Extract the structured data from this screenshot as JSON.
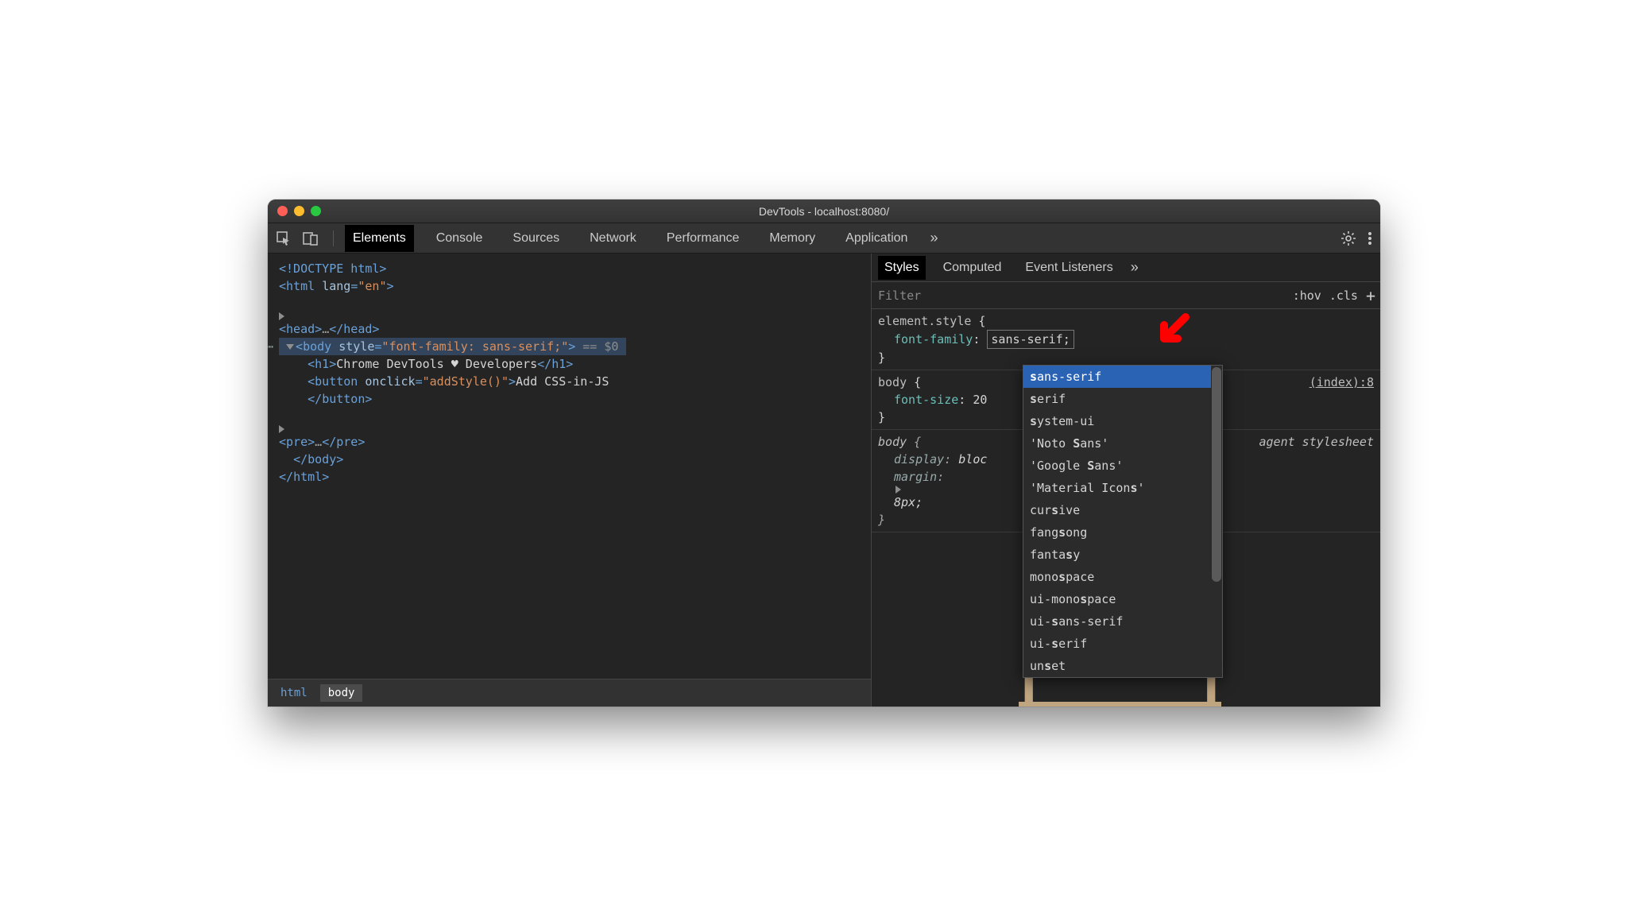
{
  "window": {
    "title": "DevTools - localhost:8080/"
  },
  "toolbar": {
    "tabs": [
      "Elements",
      "Console",
      "Sources",
      "Network",
      "Performance",
      "Memory",
      "Application"
    ],
    "active": 0
  },
  "dom": {
    "doctype": "<!DOCTYPE html>",
    "html_open": {
      "tag": "html",
      "attr": "lang",
      "val": "en"
    },
    "head_open": "head",
    "head_ell": "…",
    "body": {
      "tag": "body",
      "attr": "style",
      "val": "font-family: sans-serif;",
      "eq": "== $0"
    },
    "h1": {
      "tag": "h1",
      "text": "Chrome DevTools ♥ Developers"
    },
    "button": {
      "tag": "button",
      "attr": "onclick",
      "val": "addStyle()",
      "text": "Add CSS-in-JS"
    },
    "pre": {
      "tag": "pre",
      "ell": "…"
    },
    "body_close": "body",
    "html_close": "html"
  },
  "crumbs": [
    "html",
    "body"
  ],
  "right": {
    "tabs": [
      "Styles",
      "Computed",
      "Event Listeners"
    ],
    "active": 0,
    "filter_placeholder": "Filter",
    "hov": ":hov",
    "cls": ".cls"
  },
  "styles": {
    "rule1": {
      "selector": "element.style",
      "prop": "font-family",
      "val": "sans-serif;"
    },
    "rule2": {
      "selector": "body",
      "prop": "font-size",
      "val": "20",
      "src": "(index):8"
    },
    "rule3": {
      "selector": "body",
      "p1n": "display",
      "p1v": "bloc",
      "p2n": "margin",
      "p2v": "8px;",
      "src": "agent stylesheet"
    }
  },
  "dropdown": {
    "items": [
      {
        "pre": "",
        "b": "s",
        "post": "ans-serif",
        "sel": true
      },
      {
        "pre": "",
        "b": "s",
        "post": "erif"
      },
      {
        "pre": "",
        "b": "s",
        "post": "ystem-ui"
      },
      {
        "pre": "'Noto ",
        "b": "S",
        "post": "ans'"
      },
      {
        "pre": "'Google ",
        "b": "S",
        "post": "ans'"
      },
      {
        "pre": "'Material Icon",
        "b": "s",
        "post": "'"
      },
      {
        "pre": "cur",
        "b": "s",
        "post": "ive"
      },
      {
        "pre": "fang",
        "b": "s",
        "post": "ong"
      },
      {
        "pre": "fanta",
        "b": "s",
        "post": "y"
      },
      {
        "pre": "mono",
        "b": "s",
        "post": "pace"
      },
      {
        "pre": "ui-mono",
        "b": "s",
        "post": "pace"
      },
      {
        "pre": "ui-",
        "b": "s",
        "post": "ans-serif"
      },
      {
        "pre": "ui-",
        "b": "s",
        "post": "erif"
      },
      {
        "pre": "un",
        "b": "s",
        "post": "et"
      }
    ]
  }
}
